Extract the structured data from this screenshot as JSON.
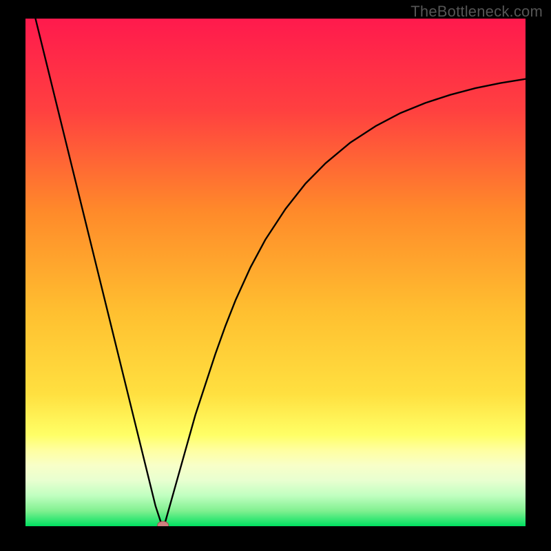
{
  "watermark": "TheBottleneck.com",
  "colors": {
    "frame": "#000000",
    "curve": "#000000",
    "marker_fill": "#d08080",
    "marker_stroke": "#a05050",
    "gradient_top": "#ff1a4d",
    "gradient_mid1": "#ff6a2a",
    "gradient_mid2": "#ffcf33",
    "gradient_mid3": "#ffff66",
    "gradient_mid4": "#e0ffb0",
    "gradient_bottom": "#00e060"
  },
  "chart_data": {
    "type": "line",
    "title": "",
    "xlabel": "",
    "ylabel": "",
    "xlim": [
      0,
      100
    ],
    "ylim": [
      0,
      100
    ],
    "series": [
      {
        "name": "bottleneck-curve",
        "x": [
          0,
          2,
          4,
          6,
          8,
          10,
          12,
          14,
          16,
          18,
          20,
          22,
          24,
          25,
          26,
          27,
          27.5,
          28,
          30,
          32,
          34,
          36,
          38,
          40,
          42,
          45,
          48,
          52,
          56,
          60,
          65,
          70,
          75,
          80,
          85,
          90,
          95,
          100
        ],
        "values": [
          108,
          100,
          92,
          84,
          76,
          68,
          60,
          52,
          44,
          36,
          28,
          20,
          12,
          8,
          4,
          1,
          0.2,
          1,
          8,
          15,
          22,
          28,
          34,
          39.5,
          44.5,
          51,
          56.5,
          62.5,
          67.5,
          71.5,
          75.6,
          78.8,
          81.4,
          83.4,
          85.0,
          86.3,
          87.3,
          88.1
        ]
      }
    ],
    "markers": [
      {
        "name": "optimum-point",
        "x": 27.5,
        "y": 0.2
      }
    ],
    "gradient_bands_y": [
      0,
      82,
      84,
      86,
      88,
      90,
      92,
      94,
      96,
      98,
      100
    ]
  }
}
